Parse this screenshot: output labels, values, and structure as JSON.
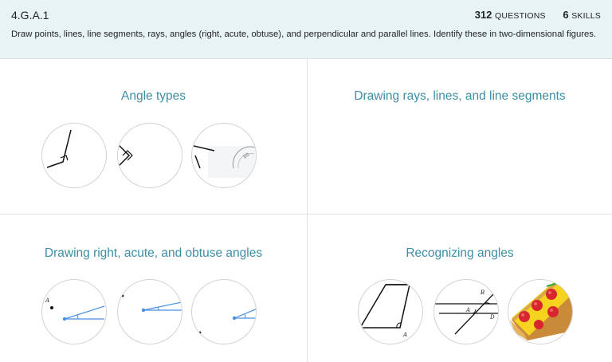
{
  "standard": {
    "code": "4.G.A.1",
    "questions_count": "312",
    "questions_label": "QUESTIONS",
    "skills_count": "6",
    "skills_label": "SKILLS",
    "description": "Draw points, lines, line segments, rays, angles (right, acute, obtuse), and perpendicular and parallel lines. Identify these in two-dimensional figures."
  },
  "skills": [
    {
      "title": "Angle types",
      "thumbnails": [
        "obtuse-angle-icon",
        "right-angle-icon",
        "protractor-angle-icon"
      ]
    },
    {
      "title": "Drawing rays, lines, and line segments",
      "thumbnails": []
    },
    {
      "title": "Drawing right, acute, and obtuse angles",
      "thumbnails": [
        "acute-angle-point-a-icon",
        "acute-angle-point-icon",
        "acute-angle-small-icon"
      ]
    },
    {
      "title": "Recognizing angles",
      "thumbnails": [
        "parallelogram-icon",
        "intersecting-lines-icon",
        "pizza-slice-icon"
      ]
    }
  ],
  "figure_labels": {
    "point_a": "A",
    "point_b": "B",
    "point_d": "D",
    "protractor_marks": "80"
  },
  "colors": {
    "header_bg": "#e8f3f5",
    "title_accent": "#3e8ea6",
    "ray_blue": "#4a90e2"
  }
}
